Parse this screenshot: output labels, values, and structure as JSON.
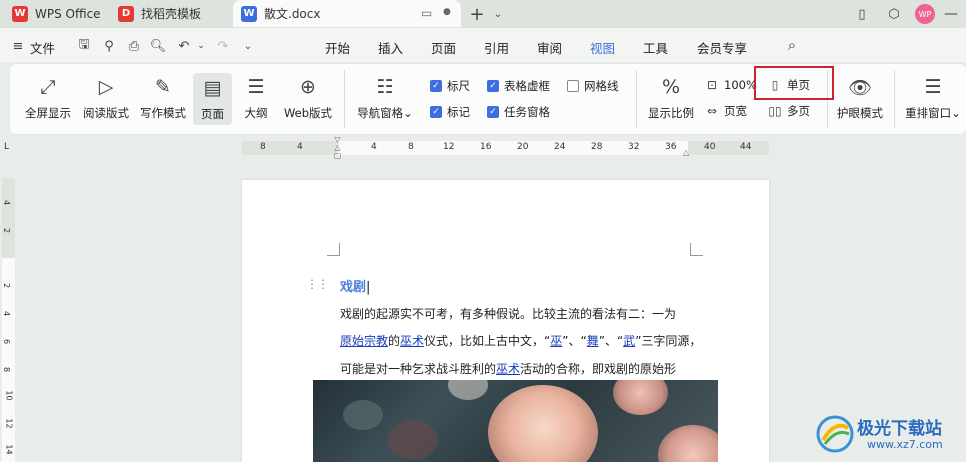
{
  "titlebar": {
    "tabs": [
      {
        "label": "WPS Office",
        "logo": "W"
      },
      {
        "label": "找稻壳模板",
        "logo": "D"
      },
      {
        "label": "散文.docx",
        "logo": "W"
      }
    ],
    "avatar": "WP",
    "colors": {
      "wps_logo": "#e53935",
      "daoke_logo": "#e53935",
      "doc_logo": "#3c6ee0",
      "avatar": "#f06292"
    }
  },
  "menubar": {
    "file_label": "文件",
    "items": [
      "开始",
      "插入",
      "页面",
      "引用",
      "审阅",
      "视图",
      "工具",
      "会员专享"
    ],
    "active": "视图"
  },
  "ribbon": {
    "big_buttons": [
      {
        "label": "全屏显示",
        "icon": "fullscreen-icon"
      },
      {
        "label": "阅读版式",
        "icon": "read-mode-icon"
      },
      {
        "label": "写作模式",
        "icon": "write-mode-icon"
      },
      {
        "label": "页面",
        "icon": "page-view-icon",
        "selected": true
      },
      {
        "label": "大纲",
        "icon": "outline-icon"
      },
      {
        "label": "Web版式",
        "icon": "web-layout-icon"
      },
      {
        "label": "导航窗格",
        "icon": "nav-pane-icon",
        "dropdown": "⌄"
      }
    ],
    "checkboxes": [
      {
        "label": "标尺",
        "checked": true
      },
      {
        "label": "表格虚框",
        "checked": true
      },
      {
        "label": "网格线",
        "checked": false
      },
      {
        "label": "标记",
        "checked": true
      },
      {
        "label": "任务窗格",
        "checked": true
      }
    ],
    "zoom": {
      "label": "显示比例",
      "percent": "100%",
      "page_width": "页宽"
    },
    "single_page": "单页",
    "multi_page": "多页",
    "eye_mode": "护眼模式",
    "rearrange": "重排窗口"
  },
  "ruler": {
    "h_ticks": [
      "8",
      "4",
      "4",
      "8",
      "12",
      "16",
      "20",
      "24",
      "28",
      "32",
      "36",
      "40",
      "44"
    ],
    "v_ticks": [
      "4",
      "2",
      "2",
      "4",
      "6",
      "8",
      "10",
      "12",
      "14"
    ],
    "corner": "L"
  },
  "document": {
    "title": "戏剧",
    "line1": "戏剧的起源实不可考，有多种假说。比较主流的看法有二：一为",
    "line2_parts": [
      "原始宗教",
      "的",
      "巫术",
      "仪式，比如上古中文，“",
      "巫",
      "”、“",
      "舞",
      "”、“",
      "武",
      "”三字同源，"
    ],
    "line3_parts": [
      "可能是对一种乞求战斗胜利的",
      "巫术",
      "活动的合称，即戏剧的原始形"
    ]
  },
  "watermark": {
    "text": "极光下载站",
    "url": "www.xz7.com"
  }
}
